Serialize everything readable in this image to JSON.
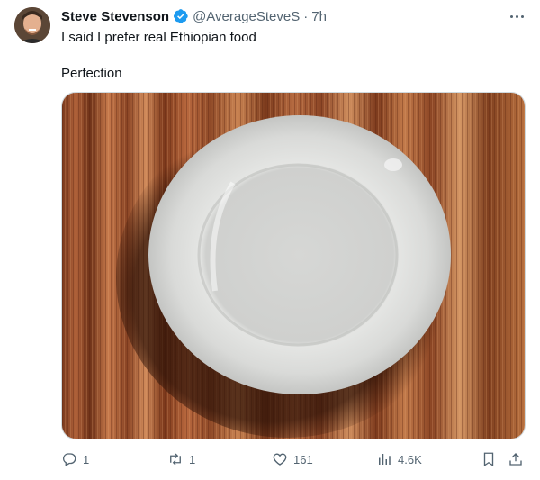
{
  "tweet": {
    "author_name": "Steve Stevenson",
    "handle": "@AverageSteveS",
    "separator": "·",
    "time": "7h",
    "lines": [
      "I said I prefer real Ethiopian food",
      "Perfection"
    ]
  },
  "actions": {
    "replies": "1",
    "retweets": "1",
    "likes": "161",
    "views": "4.6K"
  },
  "icons": {
    "verified": "verified-badge-icon",
    "more": "more-options-icon",
    "reply": "reply-icon",
    "retweet": "retweet-icon",
    "like": "heart-icon",
    "views": "views-chart-icon",
    "bookmark": "bookmark-icon",
    "share": "share-icon"
  },
  "colors": {
    "accent": "#1d9bf0",
    "muted": "#536471",
    "text": "#0f1419"
  }
}
